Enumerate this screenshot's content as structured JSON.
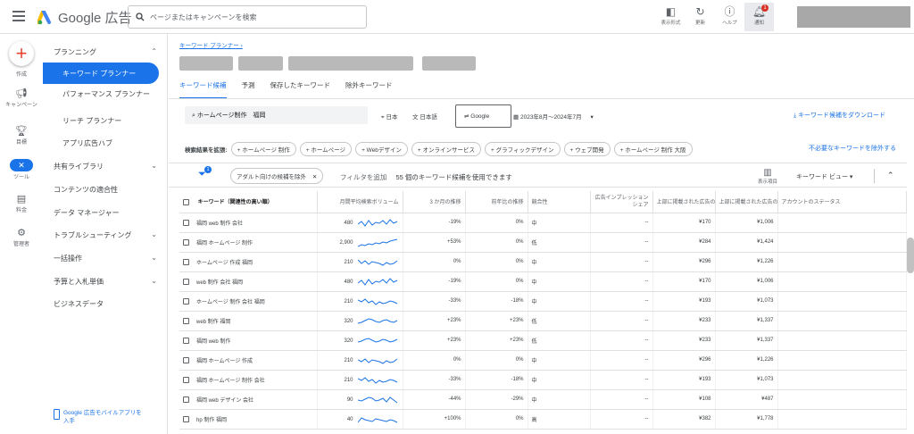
{
  "header": {
    "product_name": "Google 広告",
    "search_placeholder": "ページまたはキャンペーンを検索",
    "icons": [
      {
        "label": "表示形式",
        "icon": "appearance-icon"
      },
      {
        "label": "更新",
        "icon": "refresh-icon"
      },
      {
        "label": "ヘルプ",
        "icon": "help-icon"
      },
      {
        "label": "通知",
        "icon": "bell-icon",
        "badge": "1"
      }
    ]
  },
  "rail": {
    "create_label": "作成",
    "items": [
      {
        "label": "キャンペーン",
        "icon": "megaphone-icon"
      },
      {
        "label": "目標",
        "icon": "trophy-icon"
      },
      {
        "label": "ツール",
        "icon": "tools-icon"
      },
      {
        "label": "料金",
        "icon": "billing-icon"
      },
      {
        "label": "管理者",
        "icon": "gear-icon"
      }
    ]
  },
  "nav": {
    "section_planning": "プランニング",
    "keyword_planner": "キーワード プランナー",
    "performance_planner": "パフォーマンス プランナー",
    "reach_planner": "リーチ プランナー",
    "app_hub": "アプリ広告ハブ",
    "shared_library": "共有ライブラリ",
    "content_suitability": "コンテンツの適合性",
    "data_manager": "データ マネージャー",
    "troubleshooting": "トラブルシューティング",
    "bulk_actions": "一括操作",
    "budget_bidding": "予算と入札単価",
    "business_data": "ビジネスデータ",
    "mobile_app": "Google 広告モバイルアプリを入手"
  },
  "main": {
    "breadcrumb": "キーワード プランナー ›",
    "tabs": [
      "キーワード候補",
      "予測",
      "保存したキーワード",
      "除外キーワード"
    ],
    "search_query": "ホームページ制作　福岡",
    "location": "日本",
    "language": "日本語",
    "network": "Google",
    "date_range": "2023年8月～2024年7月",
    "download_label": "キーワード候補をダウンロード",
    "expand_label": "検索結果を拡張:",
    "expand_chips": [
      "ホームページ 制作",
      "ホームページ",
      "Webデザイン",
      "オンラインサービス",
      "グラフィックデザイン",
      "ウェブ開発",
      "ホームページ 制作 大阪"
    ],
    "exclude_label": "不必要なキーワードを除外する",
    "filter_badge": "1",
    "adult_chip": "アダルト向けの候補を除外",
    "add_filter": "フィルタを追加",
    "count_text": "55 個のキーワード候補を使用できます",
    "display_columns": "表示項目",
    "view_label": "キーワード ビュー"
  },
  "table": {
    "headers": [
      "キーワード（関連性の高い順）",
      "月間平均検索ボリューム",
      "3 か月の推移",
      "前年比の推移",
      "競合性",
      "広告インプレッション シェア",
      "上部に掲載された広告の入札単価（低額帯）",
      "上部に掲載された広告の入札単価（高額帯）",
      "アカウントのステータス"
    ],
    "rows": [
      {
        "kw": "福岡 web 制作 会社",
        "vol": "480",
        "m3": "-19%",
        "yoy": "0%",
        "comp": "中",
        "imp": "--",
        "low": "¥170",
        "high": "¥1,006"
      },
      {
        "kw": "福岡 ホームページ 制作",
        "vol": "2,900",
        "m3": "+53%",
        "yoy": "0%",
        "comp": "低",
        "imp": "--",
        "low": "¥284",
        "high": "¥1,424"
      },
      {
        "kw": "ホームページ 作成 福岡",
        "vol": "210",
        "m3": "0%",
        "yoy": "0%",
        "comp": "中",
        "imp": "--",
        "low": "¥296",
        "high": "¥1,226"
      },
      {
        "kw": "web 制作 会社 福岡",
        "vol": "480",
        "m3": "-19%",
        "yoy": "0%",
        "comp": "中",
        "imp": "--",
        "low": "¥170",
        "high": "¥1,006"
      },
      {
        "kw": "ホームページ 制作 会社 福岡",
        "vol": "210",
        "m3": "-33%",
        "yoy": "-18%",
        "comp": "中",
        "imp": "--",
        "low": "¥193",
        "high": "¥1,073"
      },
      {
        "kw": "web 制作 福岡",
        "vol": "320",
        "m3": "+23%",
        "yoy": "+23%",
        "comp": "低",
        "imp": "--",
        "low": "¥233",
        "high": "¥1,337"
      },
      {
        "kw": "福岡 web 制作",
        "vol": "320",
        "m3": "+23%",
        "yoy": "+23%",
        "comp": "低",
        "imp": "--",
        "low": "¥233",
        "high": "¥1,337"
      },
      {
        "kw": "福岡 ホームページ 作成",
        "vol": "210",
        "m3": "0%",
        "yoy": "0%",
        "comp": "中",
        "imp": "--",
        "low": "¥296",
        "high": "¥1,226"
      },
      {
        "kw": "福岡 ホームページ 制作 会社",
        "vol": "210",
        "m3": "-33%",
        "yoy": "-18%",
        "comp": "中",
        "imp": "--",
        "low": "¥193",
        "high": "¥1,073"
      },
      {
        "kw": "福岡 web デザイン 会社",
        "vol": "90",
        "m3": "-44%",
        "yoy": "-29%",
        "comp": "中",
        "imp": "--",
        "low": "¥108",
        "high": "¥487"
      },
      {
        "kw": "hp 制作 福岡",
        "vol": "40",
        "m3": "+100%",
        "yoy": "0%",
        "comp": "高",
        "imp": "--",
        "low": "¥382",
        "high": "¥1,778"
      }
    ]
  },
  "colors": {
    "accent": "#1a73e8",
    "sparkline": "#1a73e8"
  }
}
